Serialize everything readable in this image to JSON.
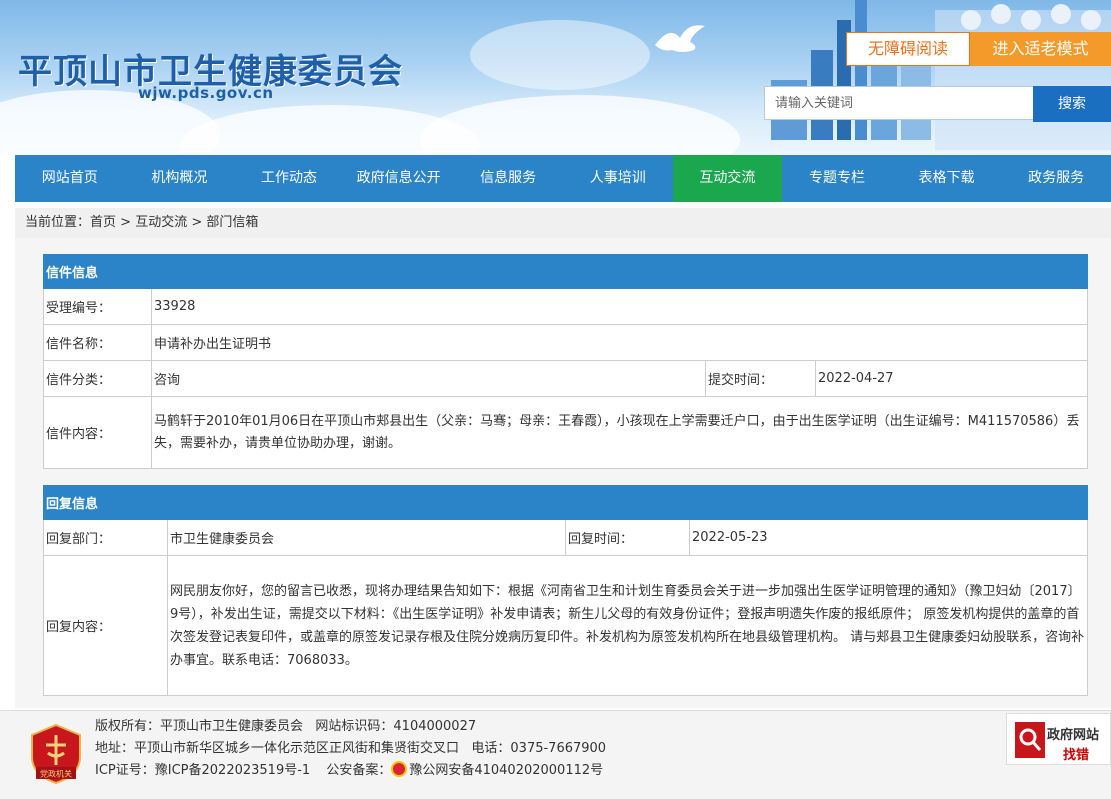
{
  "header": {
    "title": "平顶山市卫生健康委员会",
    "domain": "wjw.pds.gov.cn",
    "accessibility_label": "无障碍阅读",
    "elder_mode_label": "进入适老模式",
    "search_placeholder": "请输入关键词",
    "search_button": "搜索"
  },
  "nav": {
    "items": [
      "网站首页",
      "机构概况",
      "工作动态",
      "政府信息公开",
      "信息服务",
      "人事培训",
      "互动交流",
      "专题专栏",
      "表格下载",
      "政务服务"
    ],
    "active_index": 6
  },
  "breadcrumb": {
    "prefix": "当前位置：",
    "home": "首页",
    "sep": " > ",
    "section": "互动交流",
    "current": "部门信箱"
  },
  "letter": {
    "heading": "信件信息",
    "id_label": "受理编号：",
    "id_value": "33928",
    "name_label": "信件名称：",
    "name_value": "申请补办出生证明书",
    "category_label": "信件分类：",
    "category_value": "咨询",
    "submit_time_label": "提交时间：",
    "submit_time_value": "2022-04-27",
    "content_label": "信件内容：",
    "content_value": "马鹤轩于2010年01月06日在平顶山市郏县出生（父亲：马骞；母亲：王春霞），小孩现在上学需要迁户口，由于出生医学证明（出生证编号：M411570586）丢失，需要补办，请贵单位协助办理，谢谢。"
  },
  "reply": {
    "heading": "回复信息",
    "dept_label": "回复部门：",
    "dept_value": "市卫生健康委员会",
    "time_label": "回复时间：",
    "time_value": "2022-05-23",
    "content_label": "回复内容：",
    "content_value": "网民朋友你好，您的留言已收悉，现将办理结果告知如下：根据《河南省卫生和计划生育委员会关于进一步加强出生医学证明管理的通知》（豫卫妇幼〔2017〕9号），补发出生证，需提交以下材料：《出生医学证明》补发申请表；新生儿父母的有效身份证件；登报声明遗失作废的报纸原件； 原签发机构提供的盖章的首次签发登记表复印件，或盖章的原签发记录存根及住院分娩病历复印件。补发机构为原签发机构所在地县级管理机构。 请与郏县卫生健康委妇幼股联系，咨询补办事宜。联系电话：7068033。"
  },
  "footer": {
    "emblem_text": "党政机关",
    "line1": "版权所有：平顶山市卫生健康委员会   网站标识码：4104000027",
    "line2": "地址：平顶山市新华区城乡一体化示范区正风街和集贤街交叉口   电话：0375-7667900",
    "icp": "ICP证号：豫ICP备2022023519号-1",
    "police_label": "公安备案：",
    "police_value": "豫公网安备41040202000112号",
    "find_error_top": "政府网站",
    "find_error_bottom": "找错"
  },
  "colors": {
    "nav_bg": "#2b83c8",
    "nav_active": "#1aa74d",
    "title_blue": "#1f5fa8",
    "accent_orange": "#f39a2b"
  }
}
